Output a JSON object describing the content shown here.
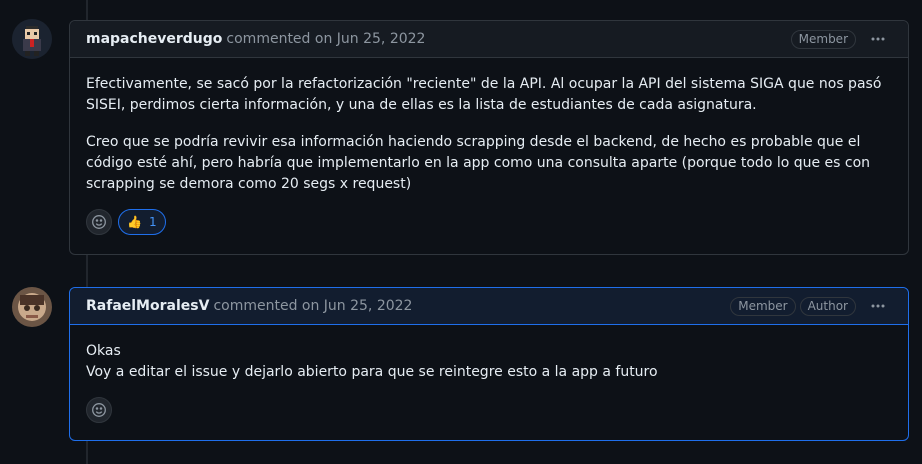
{
  "comments": [
    {
      "author": "mapacheverdugo",
      "action": "commented on",
      "date": "Jun 25, 2022",
      "badges": [
        "Member"
      ],
      "paragraphs": [
        "Efectivamente, se sacó por la refactorización \"reciente\" de la API. Al ocupar la API del sistema SIGA que nos pasó SISEI, perdimos cierta información, y una de ellas es la lista de estudiantes de cada asignatura.",
        "Creo que se podría revivir esa información haciendo scrapping desde el backend, de hecho es probable que el código esté ahí, pero habría que implementarlo en la app como una consulta aparte (porque todo lo que es con scrapping se demora como 20 segs x request)"
      ],
      "reaction": {
        "emoji": "👍",
        "count": "1"
      }
    },
    {
      "author": "RafaelMoralesV",
      "action": "commented on",
      "date": "Jun 25, 2022",
      "badges": [
        "Member",
        "Author"
      ],
      "lines": [
        "Okas",
        "Voy a editar el issue y dejarlo abierto para que se reintegre esto a la app a futuro"
      ]
    }
  ],
  "icons": {
    "kebab": "kebab-horizontal-icon",
    "smiley": "smiley-icon"
  },
  "colors": {
    "background": "#0d1117",
    "header_bg": "#161b22",
    "own_header_bg": "#121d2f",
    "accent_blue": "#1f6feb",
    "muted": "#8d96a0"
  }
}
